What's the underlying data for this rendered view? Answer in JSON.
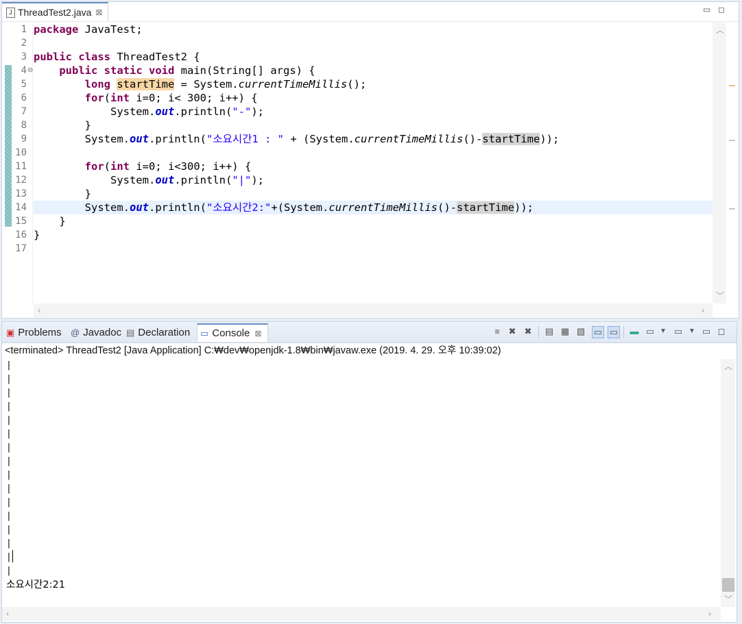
{
  "editor": {
    "tab": {
      "label": "ThreadTest2.java",
      "icon": "java-file-icon"
    },
    "line_numbers": [
      "1",
      "2",
      "3",
      "4",
      "5",
      "6",
      "7",
      "8",
      "9",
      "10",
      "11",
      "12",
      "13",
      "14",
      "15",
      "16",
      "17"
    ],
    "fold_marker": "⊖",
    "code": {
      "l1_kw": "package",
      "l1_rest": " JavaTest;",
      "l3_kw1": "public",
      "l3_kw2": "class",
      "l3_rest": " ThreadTest2 {",
      "l4_kw1": "public",
      "l4_kw2": "static",
      "l4_kw3": "void",
      "l4_rest": " main(String[] args) {",
      "l5_kw": "long",
      "l5_var": "startTime",
      "l5_mid": " = System.",
      "l5_meth": "currentTimeMillis",
      "l5_end": "();",
      "l6_kw1": "for",
      "l6_kw2": "int",
      "l6_rest": " i=0; i< 300; i++) {",
      "l7_a": "System.",
      "l7_fld": "out",
      "l7_b": ".println(",
      "l7_str": "\"-\"",
      "l7_end": ");",
      "l8": "}",
      "l9_a": "System.",
      "l9_fld": "out",
      "l9_b": ".println(",
      "l9_str": "\"소요시간1 : \"",
      "l9_c": " + (System.",
      "l9_meth": "currentTimeMillis",
      "l9_d": "()-",
      "l9_var": "startTime",
      "l9_end": "));",
      "l11_kw1": "for",
      "l11_kw2": "int",
      "l11_rest": " i=0; i<300; i++) {",
      "l12_a": "System.",
      "l12_fld": "out",
      "l12_b": ".println(",
      "l12_str": "\"|\"",
      "l12_end": ");",
      "l13": "}",
      "l14_a": "System.",
      "l14_fld": "out",
      "l14_b": ".println(",
      "l14_str": "\"소요시간2:\"",
      "l14_c": "+(System.",
      "l14_meth": "currentTimeMillis",
      "l14_d": "()-",
      "l14_var": "startTime",
      "l14_end": "));",
      "l15": "}",
      "l16": "}"
    }
  },
  "panel": {
    "tabs": [
      {
        "label": "Problems",
        "icon": "problems-icon"
      },
      {
        "label": "Javadoc",
        "icon": "javadoc-icon"
      },
      {
        "label": "Declaration",
        "icon": "declaration-icon"
      },
      {
        "label": "Console",
        "icon": "console-icon",
        "active": true
      }
    ],
    "status": "<terminated> ThreadTest2 [Java Application] C:₩dev₩openjdk-1.8₩bin₩javaw.exe (2019. 4. 29. 오후 10:39:02)",
    "output_lines": [
      "|",
      "|",
      "|",
      "|",
      "|",
      "|",
      "|",
      "|",
      "|",
      "|",
      "|",
      "|",
      "|",
      "|",
      "|",
      "|"
    ],
    "result_line": "소요시간2:21"
  }
}
